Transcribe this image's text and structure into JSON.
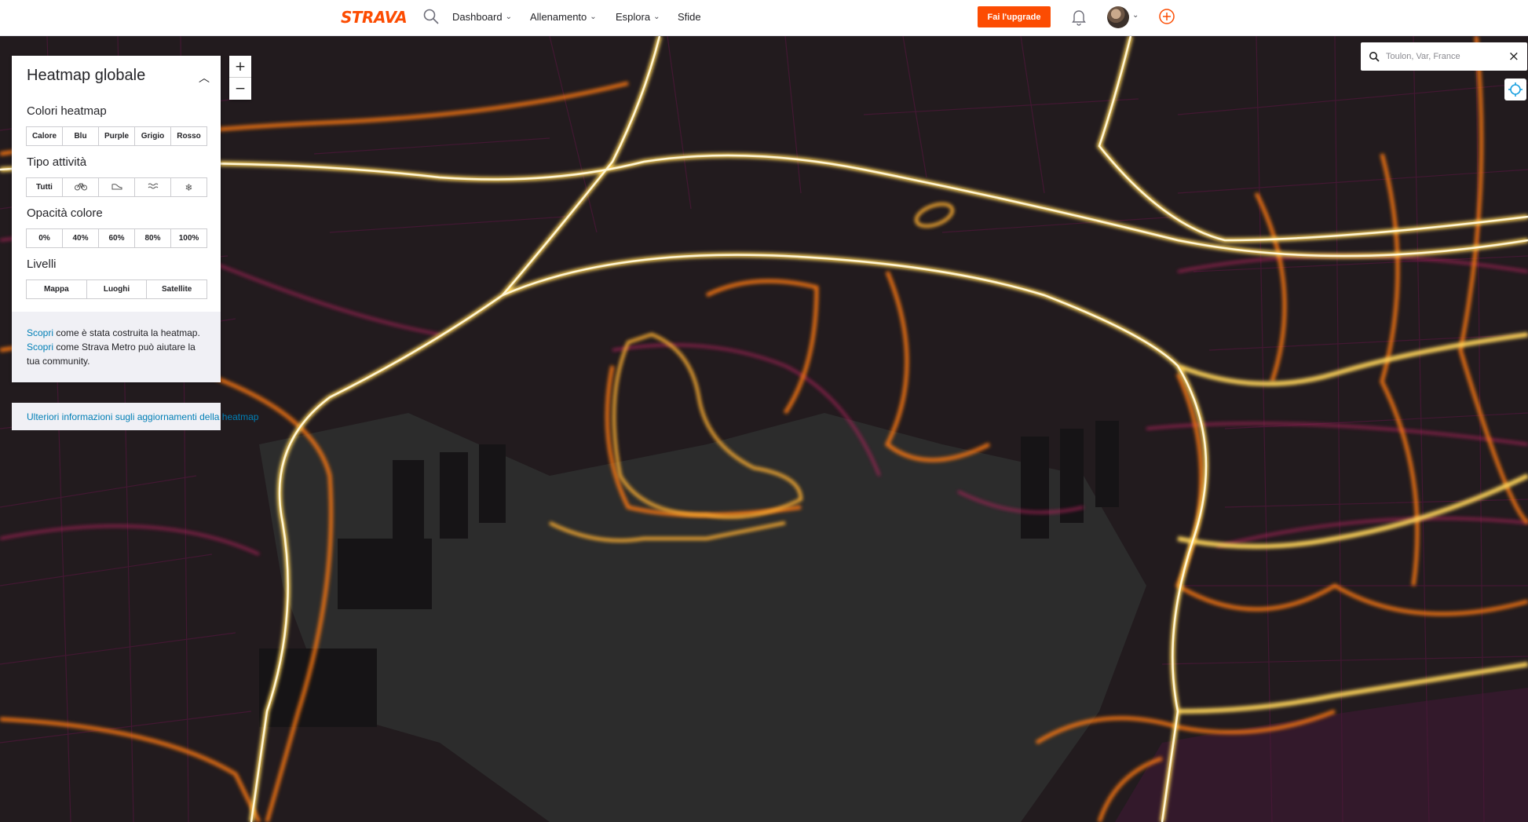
{
  "nav": {
    "logo": "STRAVA",
    "items": [
      "Dashboard",
      "Allenamento",
      "Esplora",
      "Sfide"
    ],
    "upgrade_label": "Fai l'upgrade"
  },
  "panel": {
    "title": "Heatmap globale",
    "colors_label": "Colori heatmap",
    "colors": [
      "Calore",
      "Blu",
      "Purple",
      "Grigio",
      "Rosso"
    ],
    "activity_label": "Tipo attività",
    "activity_all": "Tutti",
    "opacity_label": "Opacità colore",
    "opacity": [
      "0%",
      "40%",
      "60%",
      "80%",
      "100%"
    ],
    "layers_label": "Livelli",
    "layers": [
      "Mappa",
      "Luoghi",
      "Satellite"
    ],
    "discover_link": "Scopri",
    "discover_text_1": "come è stata costruita la heatmap.",
    "discover_text_2": "come Strava Metro può aiutare la tua community.",
    "updates_link": "Ulteriori informazioni sugli aggiornamenti della heatmap"
  },
  "search": {
    "placeholder": "Toulon, Var, France"
  },
  "zoom": {
    "in": "+",
    "out": "−"
  },
  "colors": {
    "brand": "#fc4c02",
    "link": "#007fb6",
    "heat_hot": "#fff6c8",
    "heat_mid": "#ff9a1a",
    "heat_low": "#8a1e5a"
  }
}
